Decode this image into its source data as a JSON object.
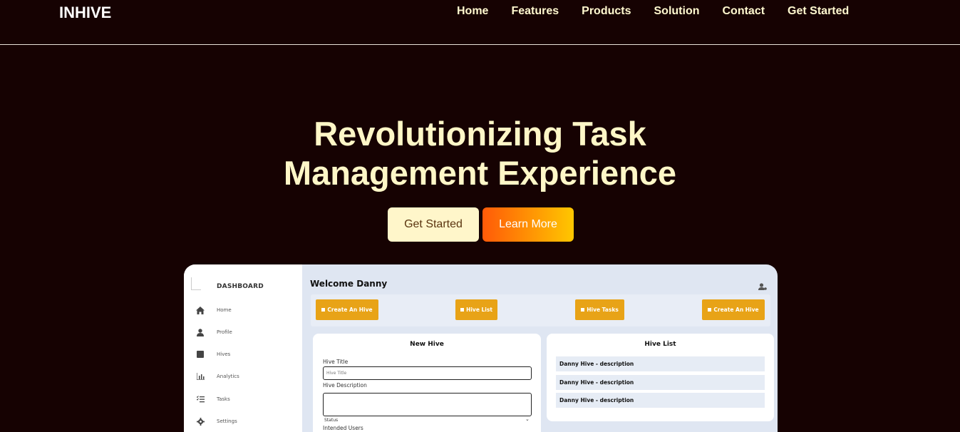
{
  "nav": {
    "logo": "INHIVE",
    "links": [
      "Home",
      "Features",
      "Products",
      "Solution",
      "Contact",
      "Get Started"
    ]
  },
  "hero": {
    "title_line1": "Revolutionizing Task",
    "title_line2": "Management Experience",
    "primary_button": "Get Started",
    "secondary_button": "Learn More"
  },
  "dashboard": {
    "sidebar": {
      "title": "DASHBOARD",
      "items": [
        {
          "label": "Home",
          "icon": "home-icon"
        },
        {
          "label": "Profile",
          "icon": "user-icon"
        },
        {
          "label": "Hives",
          "icon": "square-icon"
        },
        {
          "label": "Analytics",
          "icon": "bar-chart-icon"
        },
        {
          "label": "Tasks",
          "icon": "checklist-icon"
        },
        {
          "label": "Settings",
          "icon": "gear-icon"
        }
      ]
    },
    "welcome": "Welcome Danny",
    "actions": [
      "Create An Hive",
      "Hive List",
      "Hive Tasks",
      "Create An Hive"
    ],
    "new_hive": {
      "title": "New Hive",
      "hive_title_label": "Hive Title",
      "hive_title_placeholder": "Hive Title",
      "description_label": "Hive Description",
      "status_label": "Status",
      "intended_users_label": "Intended Users"
    },
    "hive_list": {
      "title": "Hive List",
      "rows": [
        "Danny Hive - description",
        "Danny Hive - description",
        "Danny Hive - description"
      ]
    }
  },
  "colors": {
    "background": "#160202",
    "hero_text": "#fff7c7",
    "accent_orange": "#e8a317",
    "gradient_start": "#ff5a08",
    "gradient_end": "#ffc700"
  }
}
